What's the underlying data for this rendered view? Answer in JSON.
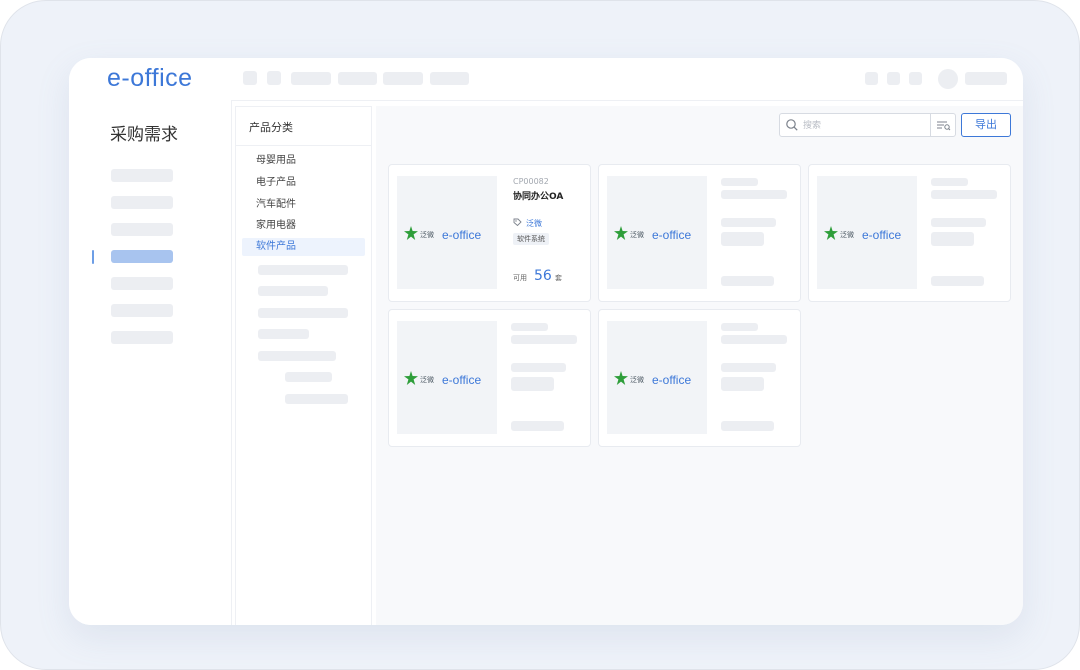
{
  "app": {
    "logo_text": "e-office",
    "accent_color": "#3d78d8"
  },
  "module": {
    "title": "采购需求"
  },
  "category_panel": {
    "header": "产品分类",
    "items": [
      {
        "label": "母婴用品",
        "active": false
      },
      {
        "label": "电子产品",
        "active": false
      },
      {
        "label": "汽车配件",
        "active": false
      },
      {
        "label": "家用电器",
        "active": false
      },
      {
        "label": "软件产品",
        "active": true
      }
    ]
  },
  "toolbar": {
    "search_placeholder": "搜索",
    "export_label": "导出"
  },
  "products": [
    {
      "code": "CP00082",
      "name": "协同办公OA",
      "vendor": "泛微",
      "tag": "软件系统",
      "available_label": "可用",
      "available_count": "56",
      "unit": "套",
      "thumb_brand_cn": "泛微",
      "thumb_brand_en": "e-office"
    }
  ],
  "placeholder_cards": [
    {
      "thumb_brand_cn": "泛微",
      "thumb_brand_en": "e-office"
    },
    {
      "thumb_brand_cn": "泛微",
      "thumb_brand_en": "e-office"
    },
    {
      "thumb_brand_cn": "泛微",
      "thumb_brand_en": "e-office"
    },
    {
      "thumb_brand_cn": "泛微",
      "thumb_brand_en": "e-office"
    }
  ],
  "icons": {
    "search": "search-icon",
    "filter": "filter-icon",
    "tag": "tag-icon",
    "brand": "weaver-logo-icon"
  }
}
